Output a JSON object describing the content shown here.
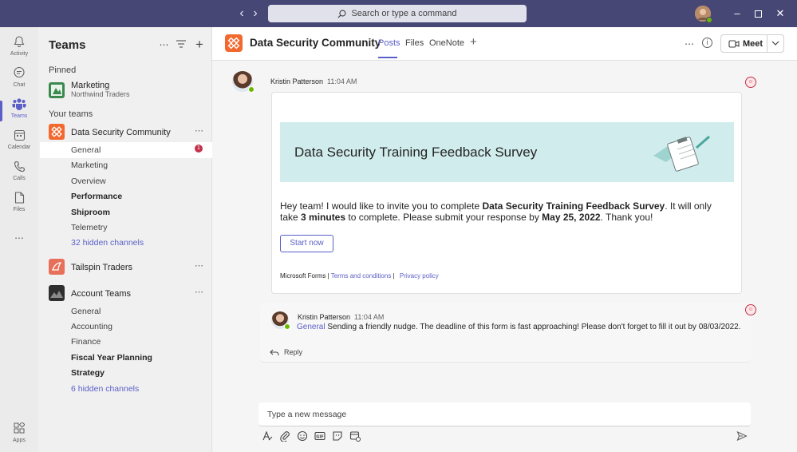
{
  "titlebar": {
    "search_placeholder": "Search or type a command"
  },
  "rail": {
    "items": [
      {
        "label": "Activity"
      },
      {
        "label": "Chat"
      },
      {
        "label": "Teams"
      },
      {
        "label": "Calendar"
      },
      {
        "label": "Calls"
      },
      {
        "label": "Files"
      }
    ],
    "more": "...",
    "apps": "Apps"
  },
  "teams_pane": {
    "title": "Teams",
    "pinned_label": "Pinned",
    "pinned": {
      "name": "Marketing",
      "sub": "Northwind Traders"
    },
    "your_teams_label": "Your teams",
    "team1": {
      "name": "Data Security Community",
      "channels": [
        "General",
        "Marketing",
        "Overview",
        "Performance",
        "Shiproom",
        "Telemetry"
      ],
      "hidden": "32 hidden channels",
      "badge": "1"
    },
    "team2": {
      "name": "Tailspin Traders"
    },
    "team3": {
      "name": "Account Teams",
      "channels": [
        "General",
        "Accounting",
        "Finance",
        "Fiscal Year Planning",
        "Strategy"
      ],
      "hidden": "6 hidden channels"
    }
  },
  "header": {
    "title": "Data Security Community",
    "tabs": [
      "Posts",
      "Files",
      "OneNote"
    ],
    "meet": "Meet"
  },
  "post": {
    "author": "Kristin Patterson",
    "time": "11:04 AM",
    "form_title": "Data Security Training Feedback Survey",
    "body_1": "Hey team! I would like to invite you to complete ",
    "body_b1": "Data Security Training Feedback Survey",
    "body_2": ". It will only take ",
    "body_b2": "3 minutes",
    "body_3": " to complete. Please submit your response by ",
    "body_b3": "May 25, 2022",
    "body_4": ". Thank you!",
    "start": "Start now",
    "footer_source": "Microsoft Forms |",
    "terms": "Terms and conditions",
    "footer_sep": " |",
    "privacy": "Privacy policy"
  },
  "reply": {
    "author": "Kristin Patterson",
    "time": "11:04 AM",
    "channel": "General",
    "text": " Sending a friendly nudge. The deadline of this form is fast approaching! Please don't forget to fill it out by 08/03/2022.",
    "reply_label": "Reply"
  },
  "compose": {
    "placeholder": "Type a new message"
  }
}
